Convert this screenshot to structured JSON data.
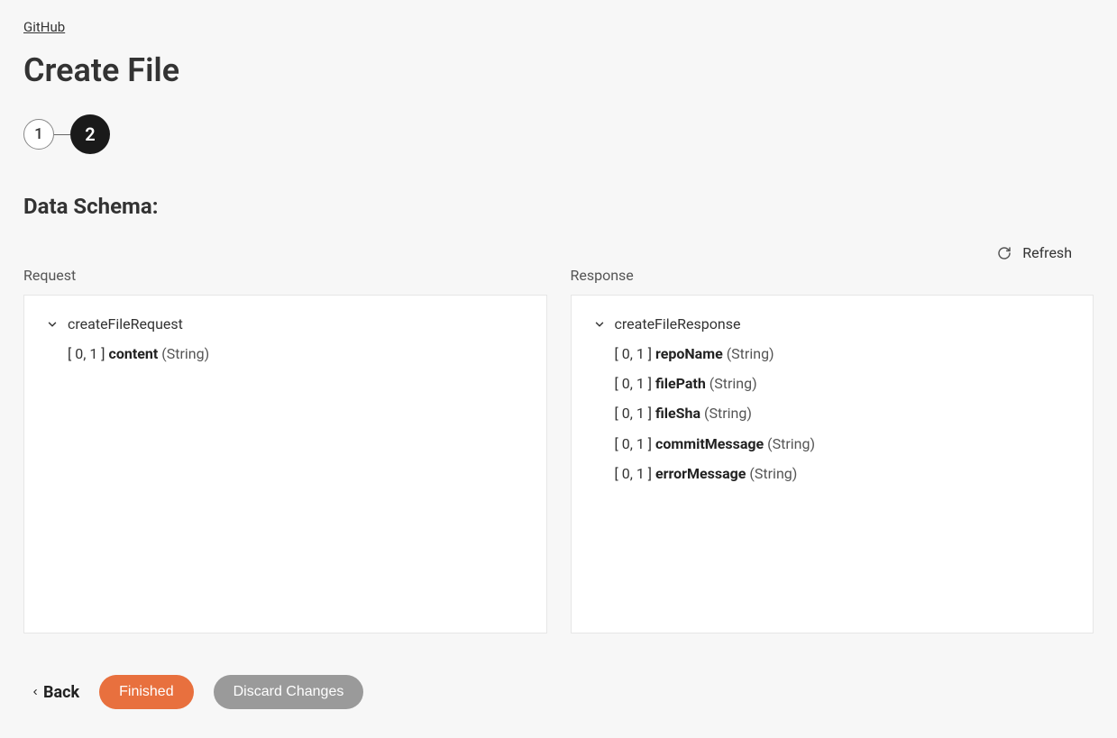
{
  "breadcrumb": "GitHub",
  "page_title": "Create File",
  "stepper": {
    "steps": [
      "1",
      "2"
    ],
    "active_index": 1
  },
  "section_title": "Data Schema:",
  "refresh_label": "Refresh",
  "request": {
    "label": "Request",
    "root": "createFileRequest",
    "fields": [
      {
        "cardinality": "[ 0, 1 ]",
        "name": "content",
        "type": "(String)"
      }
    ]
  },
  "response": {
    "label": "Response",
    "root": "createFileResponse",
    "fields": [
      {
        "cardinality": "[ 0, 1 ]",
        "name": "repoName",
        "type": "(String)"
      },
      {
        "cardinality": "[ 0, 1 ]",
        "name": "filePath",
        "type": "(String)"
      },
      {
        "cardinality": "[ 0, 1 ]",
        "name": "fileSha",
        "type": "(String)"
      },
      {
        "cardinality": "[ 0, 1 ]",
        "name": "commitMessage",
        "type": "(String)"
      },
      {
        "cardinality": "[ 0, 1 ]",
        "name": "errorMessage",
        "type": "(String)"
      }
    ]
  },
  "footer": {
    "back": "Back",
    "finished": "Finished",
    "discard": "Discard Changes"
  }
}
